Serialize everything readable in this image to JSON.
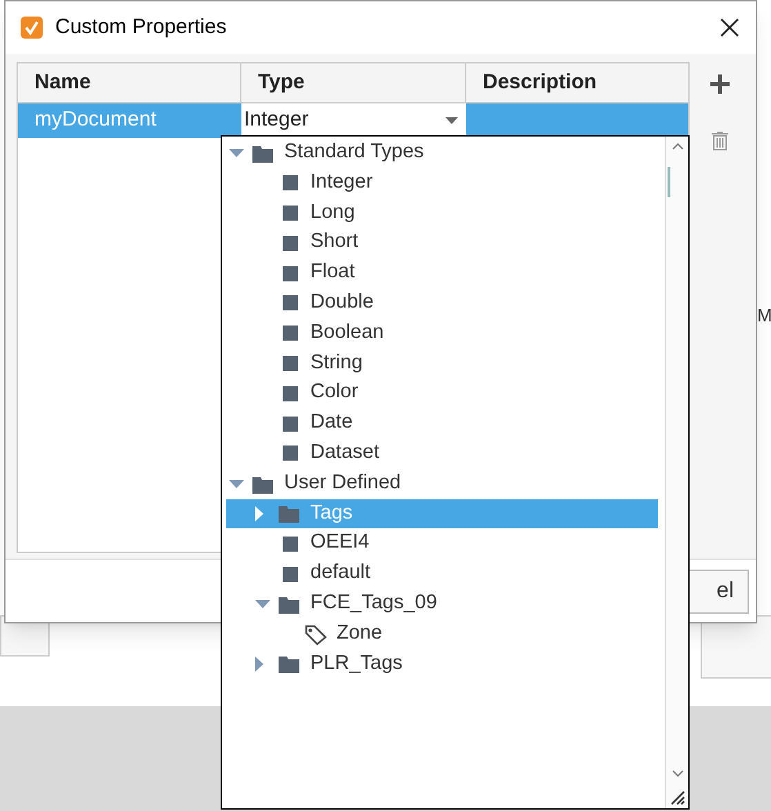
{
  "background": {
    "side_text": "M",
    "cancel_button": "el"
  },
  "window": {
    "title": "Custom Properties"
  },
  "table": {
    "columns": [
      "Name",
      "Type",
      "Description"
    ],
    "rows": [
      {
        "name": "myDocument",
        "type": "Integer",
        "selected": true
      }
    ]
  },
  "type_tree": [
    {
      "label": "Standard Types",
      "kind": "folder",
      "expanded": true,
      "selected": false,
      "children": [
        {
          "label": "Integer",
          "kind": "type",
          "selected": false
        },
        {
          "label": "Long",
          "kind": "type",
          "selected": false
        },
        {
          "label": "Short",
          "kind": "type",
          "selected": false
        },
        {
          "label": "Float",
          "kind": "type",
          "selected": false
        },
        {
          "label": "Double",
          "kind": "type",
          "selected": false
        },
        {
          "label": "Boolean",
          "kind": "type",
          "selected": false
        },
        {
          "label": "String",
          "kind": "type",
          "selected": false
        },
        {
          "label": "Color",
          "kind": "type",
          "selected": false
        },
        {
          "label": "Date",
          "kind": "type",
          "selected": false
        },
        {
          "label": "Dataset",
          "kind": "type",
          "selected": false
        }
      ]
    },
    {
      "label": "User Defined",
      "kind": "folder",
      "expanded": true,
      "selected": false,
      "children": [
        {
          "label": "Tags",
          "kind": "folder",
          "expanded": false,
          "selected": true
        },
        {
          "label": "OEEI4",
          "kind": "type",
          "selected": false
        },
        {
          "label": "default",
          "kind": "type",
          "selected": false
        },
        {
          "label": "FCE_Tags_09",
          "kind": "folder",
          "expanded": true,
          "selected": false,
          "children": [
            {
              "label": "Zone",
              "kind": "tag",
              "selected": false
            }
          ]
        },
        {
          "label": "PLR_Tags",
          "kind": "folder",
          "expanded": false,
          "selected": false
        }
      ]
    }
  ]
}
